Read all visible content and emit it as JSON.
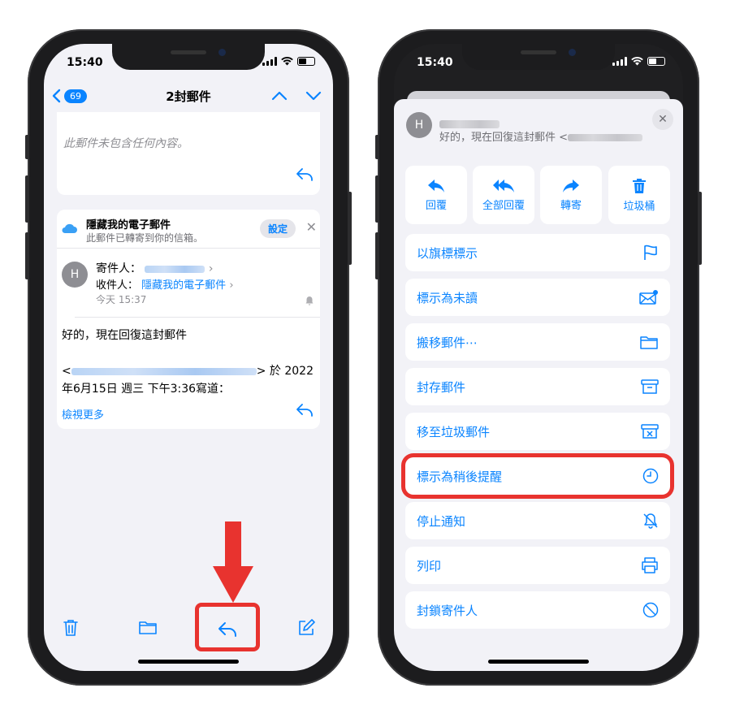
{
  "left_phone": {
    "status_time": "15:40",
    "nav": {
      "badge": "69",
      "title": "2封郵件"
    },
    "top_card": {
      "empty_text": "此郵件未包含任何內容。"
    },
    "hide_mail_banner": {
      "title": "隱藏我的電子郵件",
      "subtitle": "此郵件已轉寄到你的信箱。",
      "settings_label": "設定"
    },
    "mail": {
      "avatar_letter": "H",
      "from_label": "寄件人：",
      "to_label": "收件人：",
      "to_value": "隱藏我的電子郵件",
      "time": "今天 15:37",
      "body_line1": "好的，現在回復這封郵件",
      "quote_suffix": "> 於 2022",
      "quote_line2": "年6月15日 週三 下午3:36寫道：",
      "more_link": "檢視更多"
    }
  },
  "right_phone": {
    "status_time": "15:40",
    "sheet": {
      "avatar_letter": "H",
      "preview": "好的，現在回復這封郵件 <",
      "quick_actions": [
        {
          "label": "回覆",
          "icon": "reply-icon"
        },
        {
          "label": "全部回覆",
          "icon": "reply-all-icon"
        },
        {
          "label": "轉寄",
          "icon": "forward-icon"
        },
        {
          "label": "垃圾桶",
          "icon": "trash-icon"
        }
      ],
      "menu": [
        {
          "label": "以旗標標示",
          "icon": "flag-icon"
        },
        {
          "label": "標示為未讀",
          "icon": "unread-envelope-icon"
        },
        {
          "label": "搬移郵件⋯",
          "icon": "folder-icon"
        },
        {
          "label": "封存郵件",
          "icon": "archive-icon"
        },
        {
          "label": "移至垃圾郵件",
          "icon": "junk-icon"
        },
        {
          "label": "標示為稍後提醒",
          "icon": "clock-icon"
        },
        {
          "label": "停止通知",
          "icon": "bell-slash-icon"
        },
        {
          "label": "列印",
          "icon": "printer-icon"
        },
        {
          "label": "封鎖寄件人",
          "icon": "block-icon"
        }
      ]
    }
  },
  "colors": {
    "accent": "#0a84ff",
    "highlight": "#e8332f"
  }
}
